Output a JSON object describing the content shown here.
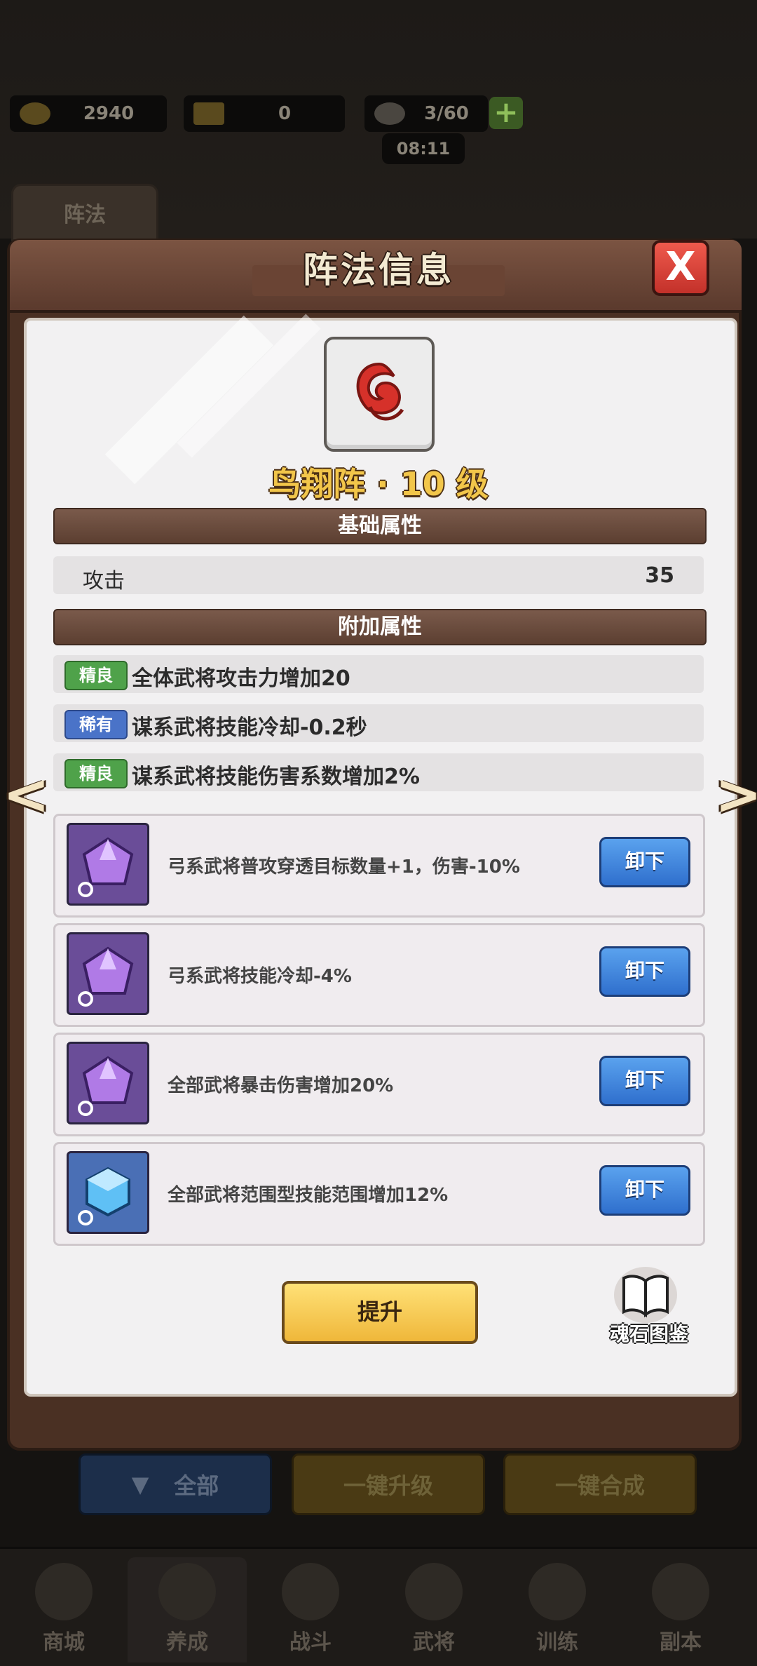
{
  "hud": {
    "gold": "2940",
    "tickets": "0",
    "stamina": "3/60",
    "timer": "08:11",
    "formation_tab": "阵法"
  },
  "dialog": {
    "title": "阵法信息",
    "close": "X",
    "formation_name": "鸟翔阵 · 10 级",
    "base_section": "基础属性",
    "base_stats": [
      {
        "label": "攻击",
        "value": "35"
      }
    ],
    "bonus_section": "附加属性",
    "bonus_stats": [
      {
        "rarity": "精良",
        "text": "全体武将攻击力增加20"
      },
      {
        "rarity": "稀有",
        "text": "谋系武将技能冷却-0.2秒"
      },
      {
        "rarity": "精良",
        "text": "谋系武将技能伤害系数增加2%"
      }
    ],
    "soul_stones": [
      {
        "desc": "弓系武将普攻穿透目标数量+1，伤害-10%",
        "button": "卸下"
      },
      {
        "desc": "弓系武将技能冷却-4%",
        "button": "卸下"
      },
      {
        "desc": "全部武将暴击伤害增加20%",
        "button": "卸下"
      },
      {
        "desc": "全部武将范围型技能范围增加12%",
        "button": "卸下"
      }
    ],
    "upgrade_button": "提升",
    "codex_label": "魂石图鉴",
    "prev_arrow": "<",
    "next_arrow": ">"
  },
  "bottom_buttons": {
    "all": "全部",
    "one_key_upgrade": "一键升级",
    "one_key_merge": "一键合成"
  },
  "nav": [
    "商城",
    "养成",
    "战斗",
    "武将",
    "训练",
    "副本"
  ],
  "colors": {
    "gem_purple": "#6a4d98",
    "gem_blue": "#4a6fb5",
    "tag_green": "#4fa24a",
    "tag_blue": "#4a73c8",
    "title_gold": "#f2c64a"
  }
}
